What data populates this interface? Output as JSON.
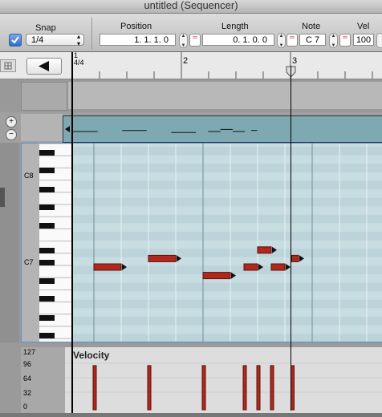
{
  "window": {
    "title": "untitled (Sequencer)"
  },
  "toolbar": {
    "snap_label": "Snap",
    "snap_checked": true,
    "snap_value": "1/4",
    "position_label": "Position",
    "position_value": "1.  1.  1.    0",
    "length_label": "Length",
    "length_value": "0.  1.  0.    0",
    "note_label": "Note",
    "note_value": "C 7",
    "vel_label": "Vel",
    "vel_value": "100"
  },
  "ruler": {
    "markers": [
      "1",
      "2",
      "3"
    ],
    "time_signature": "4/4"
  },
  "keyboard": {
    "octave_labels": [
      "C8",
      "C7"
    ]
  },
  "velocity": {
    "title": "Velocity",
    "scale": [
      "127",
      "96",
      "64",
      "32",
      "0"
    ]
  },
  "notes": [
    {
      "start_beat": 0.0,
      "length_beats": 1.0,
      "pitch_row": 10
    },
    {
      "start_beat": 2.0,
      "length_beats": 1.0,
      "pitch_row": 9
    },
    {
      "start_beat": 4.0,
      "length_beats": 1.0,
      "pitch_row": 11
    },
    {
      "start_beat": 5.5,
      "length_beats": 0.5,
      "pitch_row": 10
    },
    {
      "start_beat": 6.0,
      "length_beats": 0.5,
      "pitch_row": 8
    },
    {
      "start_beat": 6.5,
      "length_beats": 0.5,
      "pitch_row": 10
    },
    {
      "start_beat": 7.25,
      "length_beats": 0.25,
      "pitch_row": 9
    }
  ],
  "velocities": [
    100,
    100,
    100,
    100,
    100,
    100,
    100
  ],
  "colors": {
    "note": "#b0281c",
    "grid_bg": "#c7dde2",
    "selection": "#5b8fd6"
  }
}
